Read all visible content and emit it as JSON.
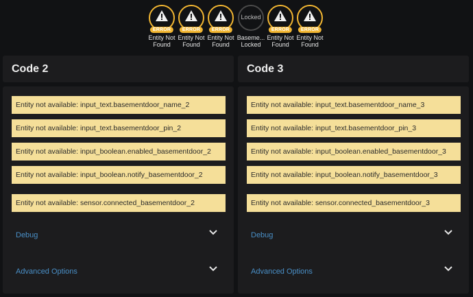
{
  "badges": [
    {
      "label": "Entity Not Found",
      "tag": "ERROR",
      "type": "error"
    },
    {
      "label": "Entity Not Found",
      "tag": "ERROR",
      "type": "error"
    },
    {
      "label": "Entity Not Found",
      "tag": "ERROR",
      "type": "error"
    },
    {
      "label": "Baseme... Locked",
      "state": "Locked",
      "type": "locked"
    },
    {
      "label": "Entity Not Found",
      "tag": "ERROR",
      "type": "error"
    },
    {
      "label": "Entity Not Found",
      "tag": "ERROR",
      "type": "error"
    }
  ],
  "cards": [
    {
      "title": "Code 2",
      "warnings": [
        "Entity not available: input_text.basementdoor_name_2",
        "Entity not available: input_text.basementdoor_pin_2",
        "Entity not available: input_boolean.enabled_basementdoor_2",
        "Entity not available: input_boolean.notify_basementdoor_2",
        "Entity not available: sensor.connected_basementdoor_2"
      ],
      "debug_label": "Debug",
      "advanced_label": "Advanced Options"
    },
    {
      "title": "Code 3",
      "warnings": [
        "Entity not available: input_text.basementdoor_name_3",
        "Entity not available: input_text.basementdoor_pin_3",
        "Entity not available: input_boolean.enabled_basementdoor_3",
        "Entity not available: input_boolean.notify_basementdoor_3",
        "Entity not available: sensor.connected_basementdoor_3"
      ],
      "debug_label": "Debug",
      "advanced_label": "Advanced Options"
    }
  ],
  "colors": {
    "error": "#f2b632",
    "warning_bg": "#f5df99",
    "link": "#4a90c8",
    "card": "#1c1c1e"
  },
  "icons": {
    "error": "warning-triangle-icon",
    "expand": "chevron-down-icon"
  }
}
